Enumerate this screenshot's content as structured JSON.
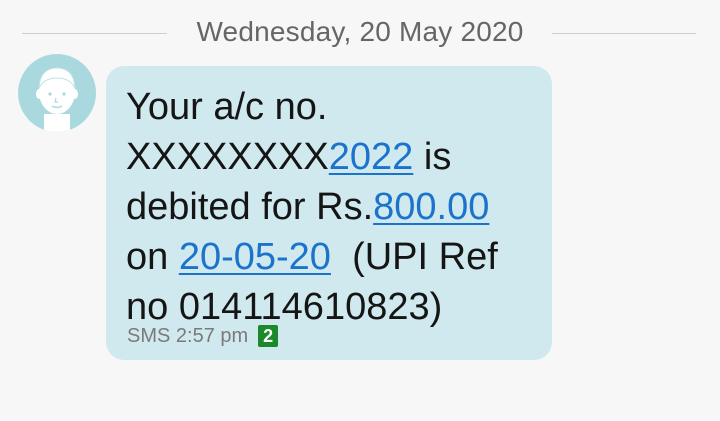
{
  "date_divider": "Wednesday, 20 May 2020",
  "avatar": {
    "icon": "person-icon",
    "color": "#a9d9de"
  },
  "message": {
    "line1": "Your a/c no.",
    "line2_prefix": "XXXXXXXX",
    "line2_link": "2022",
    "line2_suffix": " is",
    "line3_prefix": "debited for Rs.",
    "line3_link": "800.00",
    "line4_prefix": "on ",
    "line4_link": "20-05-20",
    "line4_suffix": "  (UPI Ref",
    "line5": "no 014114610823)"
  },
  "meta": {
    "channel_time": "SMS 2:57 pm",
    "sim_badge": "2",
    "sim_color": "#1a8a2a"
  },
  "colors": {
    "bubble": "#cfe9ef",
    "link": "#1b73cc",
    "background": "#f7f7f7"
  }
}
